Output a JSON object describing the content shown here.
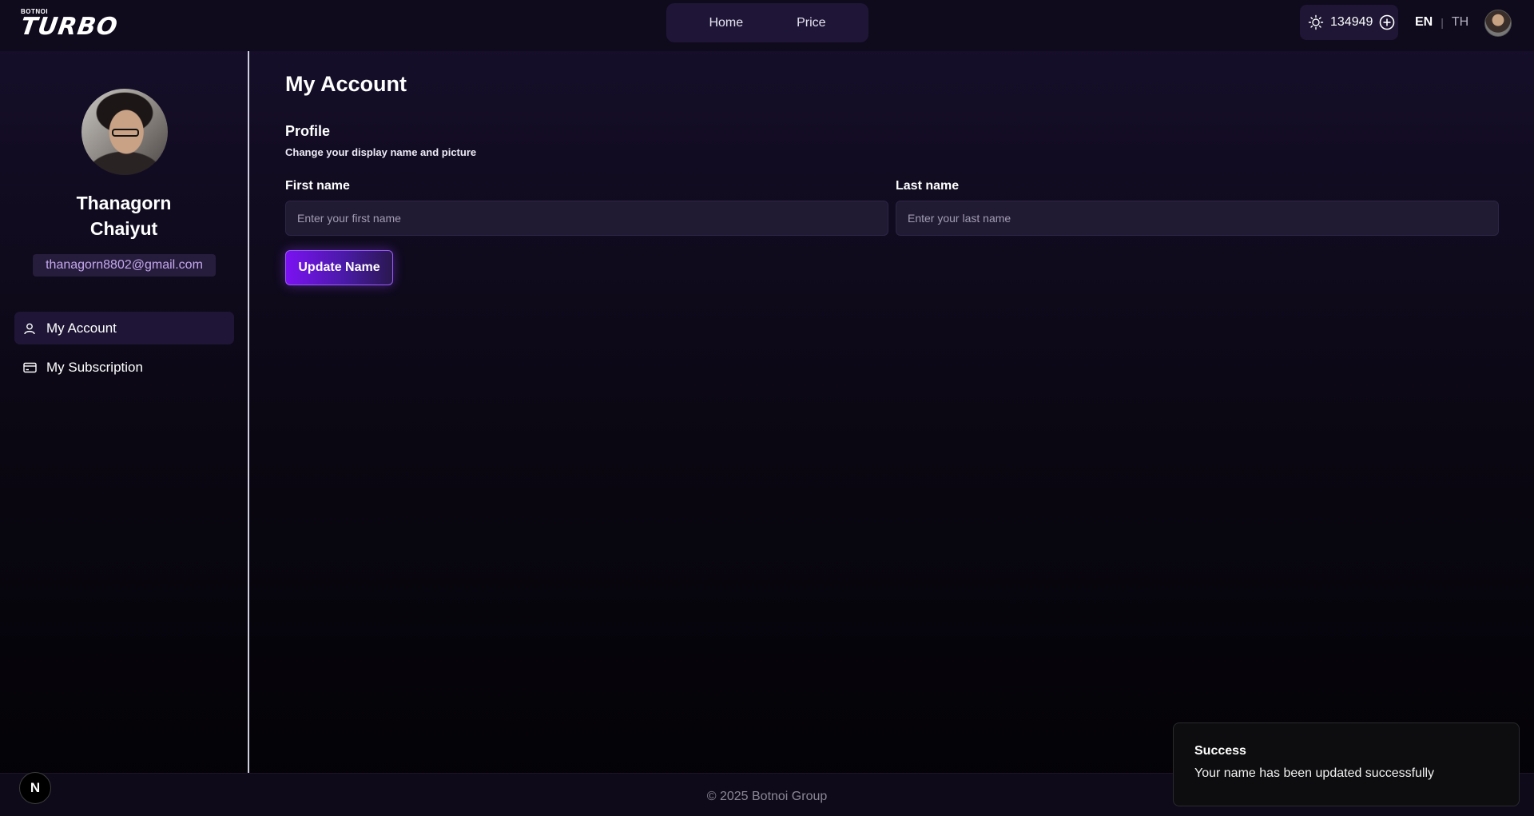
{
  "brand": {
    "small": "BOTNOI",
    "big": "TURBO"
  },
  "nav": {
    "home": "Home",
    "price": "Price"
  },
  "credits": {
    "amount": "134949"
  },
  "lang": {
    "en": "EN",
    "sep": "|",
    "th": "TH"
  },
  "profile": {
    "first": "Thanagorn",
    "last": "Chaiyut",
    "email": "thanagorn8802@gmail.com"
  },
  "sidebar": {
    "items": [
      {
        "label": "My Account",
        "icon": "user-icon"
      },
      {
        "label": "My Subscription",
        "icon": "card-icon"
      }
    ]
  },
  "main": {
    "title": "My Account",
    "section_title": "Profile",
    "section_sub": "Change your display name and picture",
    "first_label": "First name",
    "first_placeholder": "Enter your first name",
    "first_value": "",
    "last_label": "Last name",
    "last_placeholder": "Enter your last name",
    "last_value": "",
    "button": "Update Name"
  },
  "footer": {
    "text": "© 2025 Botnoi Group"
  },
  "n_badge": "N",
  "toast": {
    "title": "Success",
    "message": "Your name has been updated successfully"
  },
  "colors": {
    "accent": "#7b12f2",
    "email_text": "#c5a8ee",
    "panel": "#1f1637"
  }
}
